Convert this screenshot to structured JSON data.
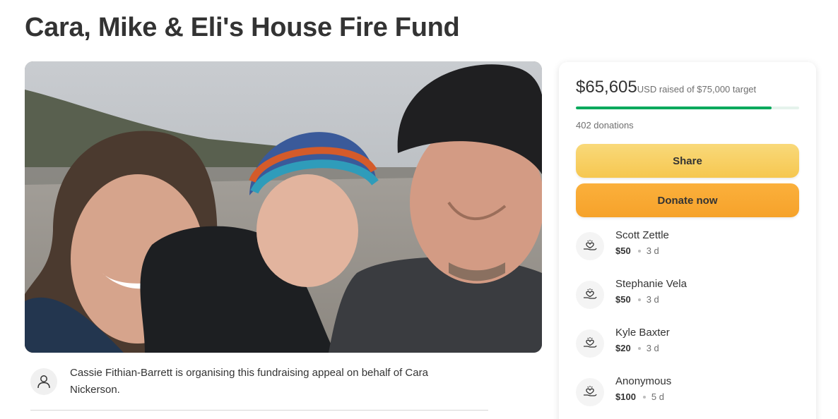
{
  "page": {
    "title": "Cara, Mike & Eli's House Fire Fund"
  },
  "hero": {
    "icon": "family-photo",
    "description": "Selfie of two adults and a toddler in a knit hat on a beach"
  },
  "organiser": {
    "icon": "person-icon",
    "text": "Cassie Fithian-Barrett is organising this fundraising appeal on behalf of Cara Nickerson."
  },
  "fundraiser": {
    "amount": "$65,605",
    "raised_text": "USD raised of $75,000 target",
    "progress": 0.875,
    "donations_count": "402 donations",
    "accent_color": "#02a95c",
    "share_label": "Share",
    "donate_label": "Donate now"
  },
  "donations": [
    {
      "name": "Scott Zettle",
      "amount": "$50",
      "time": "3 d",
      "icon": "heart-hand-icon"
    },
    {
      "name": "Stephanie Vela",
      "amount": "$50",
      "time": "3 d",
      "icon": "heart-hand-icon"
    },
    {
      "name": "Kyle Baxter",
      "amount": "$20",
      "time": "3 d",
      "icon": "heart-hand-icon"
    },
    {
      "name": "Anonymous",
      "amount": "$100",
      "time": "5 d",
      "icon": "heart-hand-icon"
    }
  ]
}
